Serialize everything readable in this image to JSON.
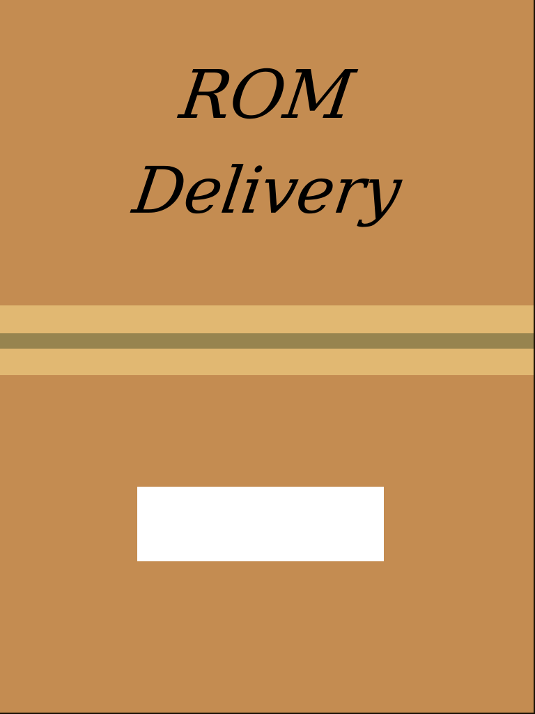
{
  "title": {
    "line1": "ROM",
    "line2": "Delivery"
  },
  "colors": {
    "background": "#c48c51",
    "stripe_light": "#e1b872",
    "stripe_dark": "#97844f",
    "button": "#ffffff"
  },
  "button": {
    "label": ""
  }
}
